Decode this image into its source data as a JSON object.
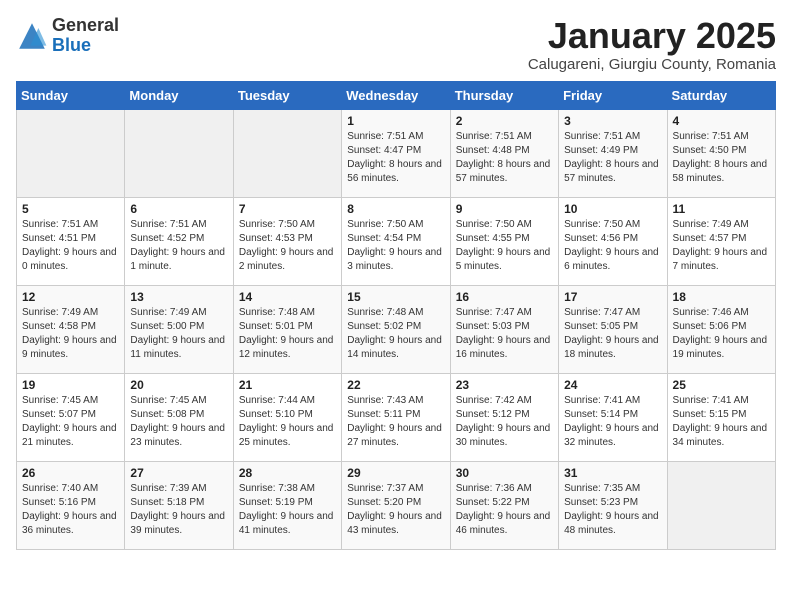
{
  "logo": {
    "general": "General",
    "blue": "Blue"
  },
  "header": {
    "month": "January 2025",
    "location": "Calugareni, Giurgiu County, Romania"
  },
  "weekdays": [
    "Sunday",
    "Monday",
    "Tuesday",
    "Wednesday",
    "Thursday",
    "Friday",
    "Saturday"
  ],
  "weeks": [
    [
      {
        "day": "",
        "info": ""
      },
      {
        "day": "",
        "info": ""
      },
      {
        "day": "",
        "info": ""
      },
      {
        "day": "1",
        "info": "Sunrise: 7:51 AM\nSunset: 4:47 PM\nDaylight: 8 hours and 56 minutes."
      },
      {
        "day": "2",
        "info": "Sunrise: 7:51 AM\nSunset: 4:48 PM\nDaylight: 8 hours and 57 minutes."
      },
      {
        "day": "3",
        "info": "Sunrise: 7:51 AM\nSunset: 4:49 PM\nDaylight: 8 hours and 57 minutes."
      },
      {
        "day": "4",
        "info": "Sunrise: 7:51 AM\nSunset: 4:50 PM\nDaylight: 8 hours and 58 minutes."
      }
    ],
    [
      {
        "day": "5",
        "info": "Sunrise: 7:51 AM\nSunset: 4:51 PM\nDaylight: 9 hours and 0 minutes."
      },
      {
        "day": "6",
        "info": "Sunrise: 7:51 AM\nSunset: 4:52 PM\nDaylight: 9 hours and 1 minute."
      },
      {
        "day": "7",
        "info": "Sunrise: 7:50 AM\nSunset: 4:53 PM\nDaylight: 9 hours and 2 minutes."
      },
      {
        "day": "8",
        "info": "Sunrise: 7:50 AM\nSunset: 4:54 PM\nDaylight: 9 hours and 3 minutes."
      },
      {
        "day": "9",
        "info": "Sunrise: 7:50 AM\nSunset: 4:55 PM\nDaylight: 9 hours and 5 minutes."
      },
      {
        "day": "10",
        "info": "Sunrise: 7:50 AM\nSunset: 4:56 PM\nDaylight: 9 hours and 6 minutes."
      },
      {
        "day": "11",
        "info": "Sunrise: 7:49 AM\nSunset: 4:57 PM\nDaylight: 9 hours and 7 minutes."
      }
    ],
    [
      {
        "day": "12",
        "info": "Sunrise: 7:49 AM\nSunset: 4:58 PM\nDaylight: 9 hours and 9 minutes."
      },
      {
        "day": "13",
        "info": "Sunrise: 7:49 AM\nSunset: 5:00 PM\nDaylight: 9 hours and 11 minutes."
      },
      {
        "day": "14",
        "info": "Sunrise: 7:48 AM\nSunset: 5:01 PM\nDaylight: 9 hours and 12 minutes."
      },
      {
        "day": "15",
        "info": "Sunrise: 7:48 AM\nSunset: 5:02 PM\nDaylight: 9 hours and 14 minutes."
      },
      {
        "day": "16",
        "info": "Sunrise: 7:47 AM\nSunset: 5:03 PM\nDaylight: 9 hours and 16 minutes."
      },
      {
        "day": "17",
        "info": "Sunrise: 7:47 AM\nSunset: 5:05 PM\nDaylight: 9 hours and 18 minutes."
      },
      {
        "day": "18",
        "info": "Sunrise: 7:46 AM\nSunset: 5:06 PM\nDaylight: 9 hours and 19 minutes."
      }
    ],
    [
      {
        "day": "19",
        "info": "Sunrise: 7:45 AM\nSunset: 5:07 PM\nDaylight: 9 hours and 21 minutes."
      },
      {
        "day": "20",
        "info": "Sunrise: 7:45 AM\nSunset: 5:08 PM\nDaylight: 9 hours and 23 minutes."
      },
      {
        "day": "21",
        "info": "Sunrise: 7:44 AM\nSunset: 5:10 PM\nDaylight: 9 hours and 25 minutes."
      },
      {
        "day": "22",
        "info": "Sunrise: 7:43 AM\nSunset: 5:11 PM\nDaylight: 9 hours and 27 minutes."
      },
      {
        "day": "23",
        "info": "Sunrise: 7:42 AM\nSunset: 5:12 PM\nDaylight: 9 hours and 30 minutes."
      },
      {
        "day": "24",
        "info": "Sunrise: 7:41 AM\nSunset: 5:14 PM\nDaylight: 9 hours and 32 minutes."
      },
      {
        "day": "25",
        "info": "Sunrise: 7:41 AM\nSunset: 5:15 PM\nDaylight: 9 hours and 34 minutes."
      }
    ],
    [
      {
        "day": "26",
        "info": "Sunrise: 7:40 AM\nSunset: 5:16 PM\nDaylight: 9 hours and 36 minutes."
      },
      {
        "day": "27",
        "info": "Sunrise: 7:39 AM\nSunset: 5:18 PM\nDaylight: 9 hours and 39 minutes."
      },
      {
        "day": "28",
        "info": "Sunrise: 7:38 AM\nSunset: 5:19 PM\nDaylight: 9 hours and 41 minutes."
      },
      {
        "day": "29",
        "info": "Sunrise: 7:37 AM\nSunset: 5:20 PM\nDaylight: 9 hours and 43 minutes."
      },
      {
        "day": "30",
        "info": "Sunrise: 7:36 AM\nSunset: 5:22 PM\nDaylight: 9 hours and 46 minutes."
      },
      {
        "day": "31",
        "info": "Sunrise: 7:35 AM\nSunset: 5:23 PM\nDaylight: 9 hours and 48 minutes."
      },
      {
        "day": "",
        "info": ""
      }
    ]
  ]
}
